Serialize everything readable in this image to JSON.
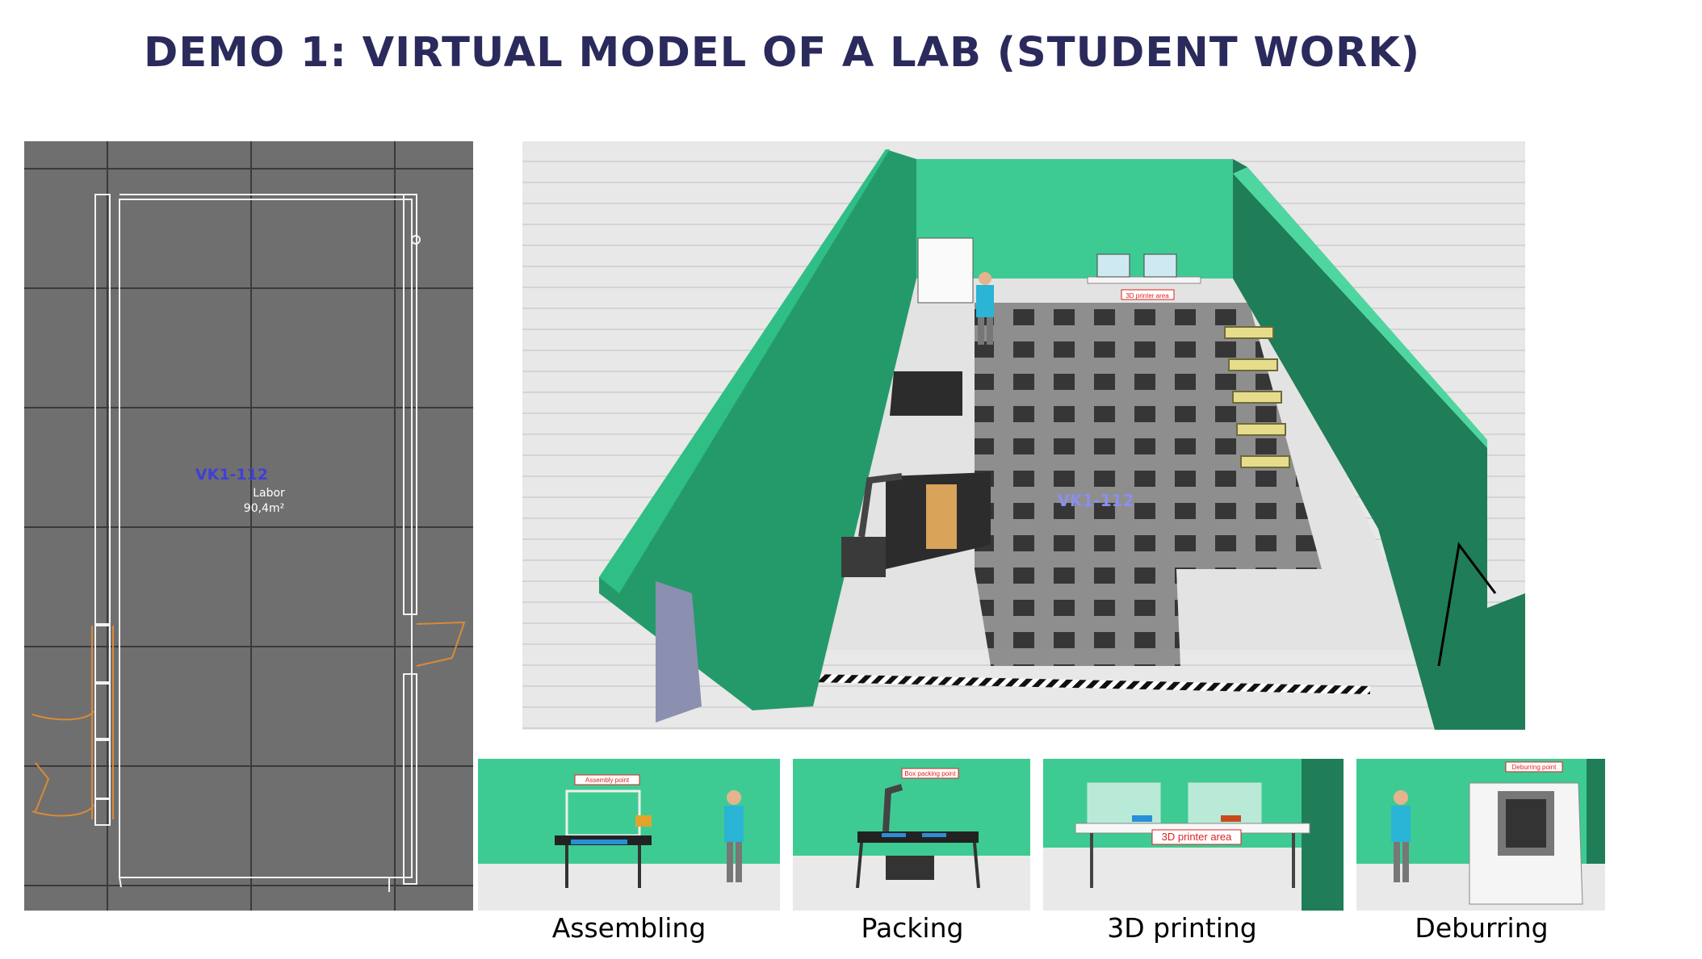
{
  "title": "DEMO 1: VIRTUAL MODEL OF A LAB (STUDENT WORK)",
  "floorplan": {
    "room_id": "VK1-112",
    "room_type": "Labor",
    "room_area": "90,4m²"
  },
  "view3d": {
    "room_id": "VK1-112",
    "sign_3d": "3D printer area"
  },
  "thumbnails": [
    {
      "caption": "Assembling",
      "sign": "Assembly point"
    },
    {
      "caption": "Packing",
      "sign": "Box packing point"
    },
    {
      "caption": "3D printing",
      "sign": "3D printer area"
    },
    {
      "caption": "Deburring",
      "sign": "Deburring point"
    }
  ],
  "colors": {
    "title": "#2b2a5c",
    "wall_green": "#3ecb93",
    "wall_dark": "#1f7d58",
    "floorplan_bg": "#6f6f6f"
  }
}
